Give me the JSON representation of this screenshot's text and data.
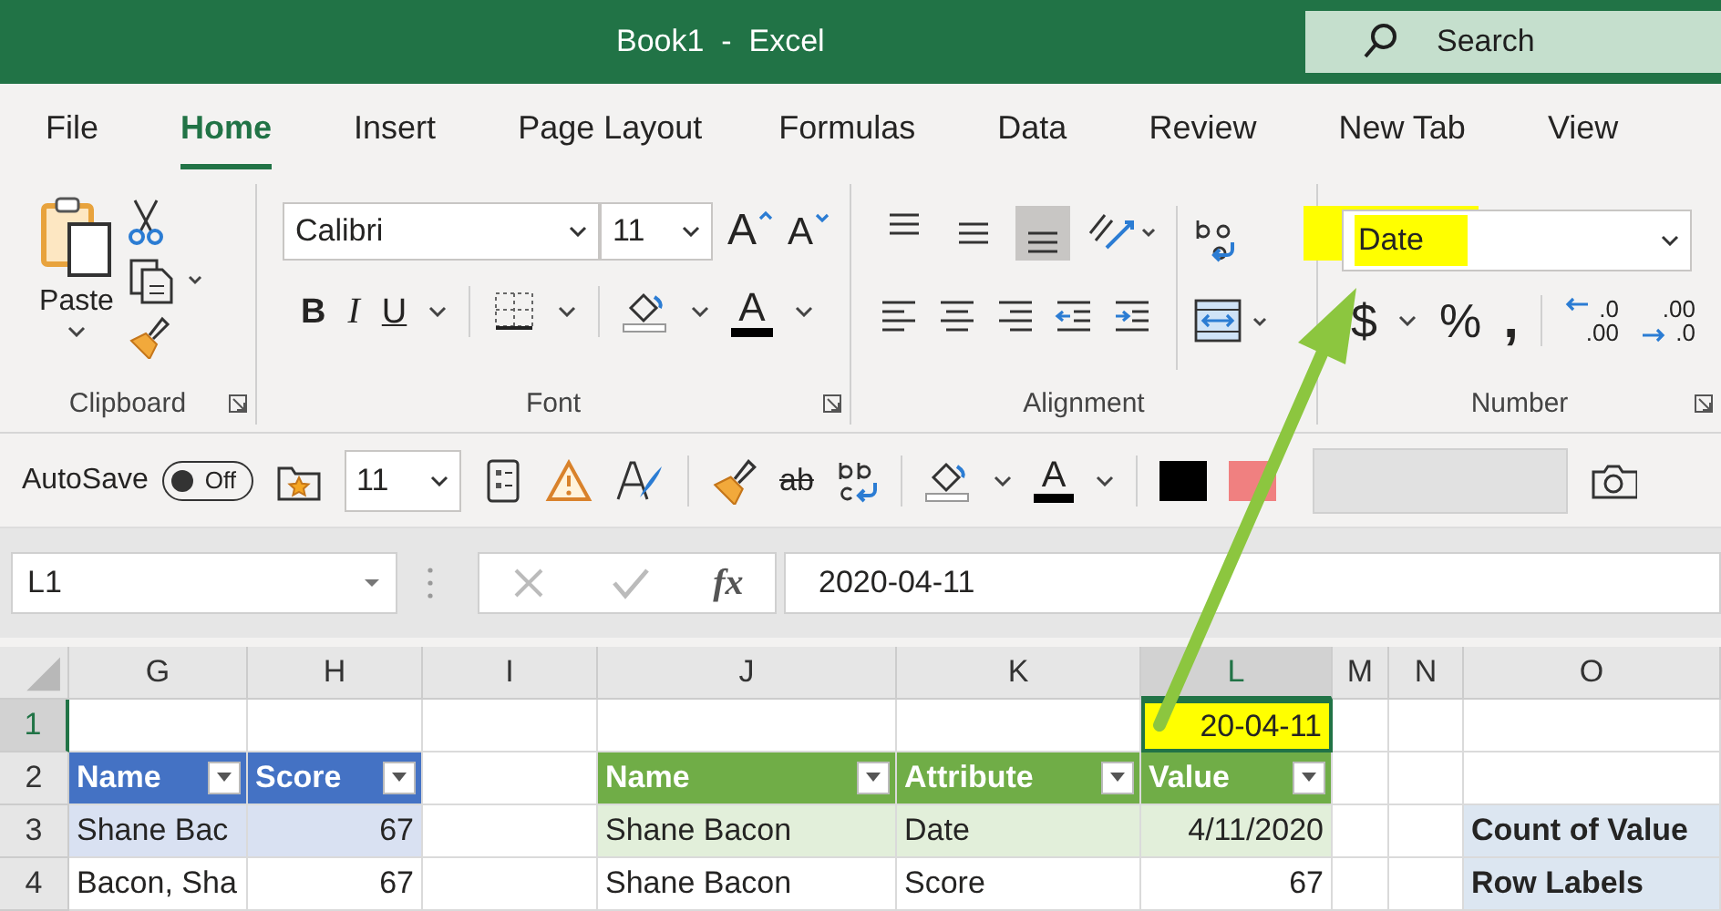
{
  "title_bar": {
    "title": "Book1  -  Excel",
    "search_placeholder": "Search"
  },
  "tabs": [
    {
      "label": "File",
      "selected": false
    },
    {
      "label": "Home",
      "selected": true
    },
    {
      "label": "Insert",
      "selected": false
    },
    {
      "label": "Page Layout",
      "selected": false
    },
    {
      "label": "Formulas",
      "selected": false
    },
    {
      "label": "Data",
      "selected": false
    },
    {
      "label": "Review",
      "selected": false
    },
    {
      "label": "New Tab",
      "selected": false
    },
    {
      "label": "View",
      "selected": false
    }
  ],
  "clipboard": {
    "paste_label": "Paste",
    "group_label": "Clipboard"
  },
  "font": {
    "name": "Calibri",
    "size": "11",
    "grow": "A",
    "shrink": "A",
    "bold": "B",
    "italic": "I",
    "underline": "U",
    "font_color": "A",
    "group_label": "Font"
  },
  "alignment": {
    "group_label": "Alignment",
    "vertical": [
      {
        "kind": "top",
        "selected": false
      },
      {
        "kind": "middle",
        "selected": false
      },
      {
        "kind": "bottom",
        "selected": true
      }
    ],
    "horizontal": [
      {
        "kind": "left"
      },
      {
        "kind": "center"
      },
      {
        "kind": "right"
      },
      {
        "kind": "outdent"
      },
      {
        "kind": "indent"
      }
    ]
  },
  "number": {
    "format": "Date",
    "highlighted": true,
    "currency": "$",
    "percent": "%",
    "comma": ",",
    "group_label": "Number",
    "decimal_buttons": [
      {
        "kind": "increase",
        "top": ".0",
        "bottom": ".00"
      },
      {
        "kind": "decrease",
        "top": ".00",
        "bottom": ".0"
      }
    ]
  },
  "quick_access": {
    "autosave_label": "AutoSave",
    "autosave": {
      "label": "Off",
      "on": false
    },
    "size": "11",
    "strike": "ab",
    "font_color": "A",
    "swatches": [
      {
        "color": "#000000"
      },
      {
        "color": "#f08080"
      }
    ]
  },
  "formula_bar": {
    "name_box": "L1",
    "fx": "fx",
    "formula": "2020-04-11"
  },
  "grid": {
    "columns": [
      {
        "label": "G",
        "selected": false
      },
      {
        "label": "H",
        "selected": false
      },
      {
        "label": "I",
        "selected": false
      },
      {
        "label": "J",
        "selected": false
      },
      {
        "label": "K",
        "selected": false
      },
      {
        "label": "L",
        "selected": true
      },
      {
        "label": "M",
        "selected": false
      },
      {
        "label": "N",
        "selected": false
      },
      {
        "label": "O",
        "selected": false
      }
    ],
    "rows": [
      {
        "label": "1",
        "selected": true,
        "cells": [
          {
            "kind": "empty"
          },
          {
            "kind": "empty"
          },
          {
            "kind": "empty"
          },
          {
            "kind": "empty"
          },
          {
            "kind": "empty"
          },
          {
            "kind": "active",
            "text": "20-04-11",
            "selected": true
          },
          {
            "kind": "empty"
          },
          {
            "kind": "empty"
          },
          {
            "kind": "empty"
          }
        ]
      },
      {
        "label": "2",
        "selected": false,
        "cells": [
          {
            "kind": "header",
            "text": "Name",
            "filter": true
          },
          {
            "kind": "header",
            "text": "Score",
            "filter": true
          },
          {
            "kind": "empty"
          },
          {
            "kind": "header",
            "text": "Name",
            "filter": true
          },
          {
            "kind": "header",
            "text": "Attribute",
            "filter": true
          },
          {
            "kind": "header",
            "text": "Value",
            "filter": true
          },
          {
            "kind": "empty"
          },
          {
            "kind": "empty"
          },
          {
            "kind": "empty"
          }
        ]
      },
      {
        "label": "3",
        "selected": false,
        "cells": [
          {
            "kind": "band-text",
            "text": "Shane Bac"
          },
          {
            "kind": "band-number",
            "text": "67"
          },
          {
            "kind": "empty"
          },
          {
            "kind": "band-text",
            "text": "Shane Bacon"
          },
          {
            "kind": "band-text",
            "text": "Date"
          },
          {
            "kind": "band-number",
            "text": "4/11/2020"
          },
          {
            "kind": "empty"
          },
          {
            "kind": "empty"
          },
          {
            "kind": "pivot",
            "text": "Count of Value"
          }
        ]
      },
      {
        "label": "4",
        "selected": false,
        "cells": [
          {
            "kind": "text",
            "text": "Bacon, Sha"
          },
          {
            "kind": "number",
            "text": "67"
          },
          {
            "kind": "empty"
          },
          {
            "kind": "text",
            "text": "Shane Bacon"
          },
          {
            "kind": "text",
            "text": "Score"
          },
          {
            "kind": "number",
            "text": "67"
          },
          {
            "kind": "empty"
          },
          {
            "kind": "empty"
          },
          {
            "kind": "pivot",
            "text": "Row Labels"
          }
        ]
      }
    ]
  }
}
